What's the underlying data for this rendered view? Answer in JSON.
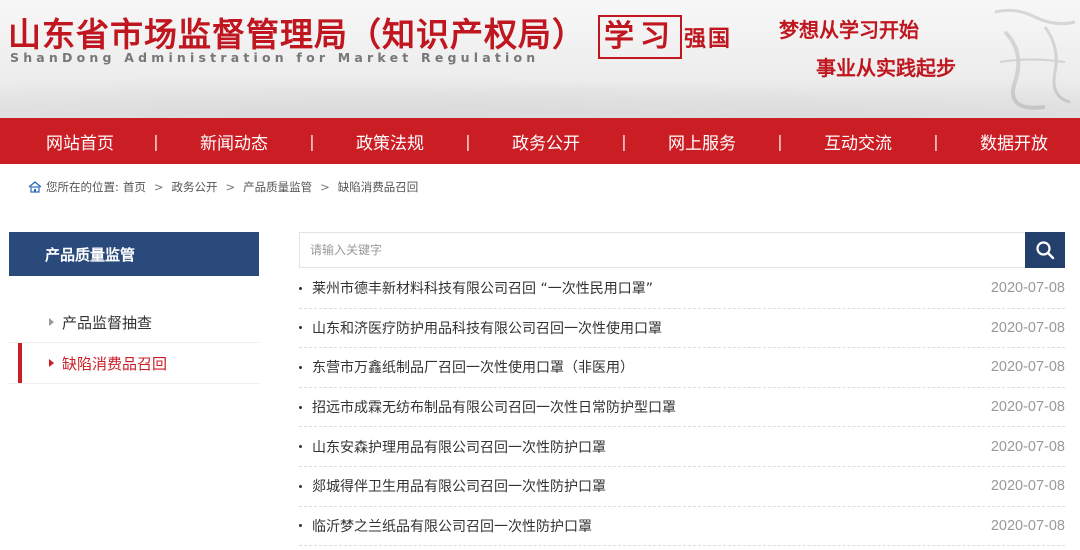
{
  "header": {
    "title": "山东省市场监督管理局（知识产权局）",
    "subtitle": "ShanDong Administration for Market Regulation",
    "xuexi_box": "学习",
    "xuexi_small": "强国",
    "slogan_line1": "梦想从学习开始",
    "slogan_line2": "事业从实践起步"
  },
  "nav": {
    "items": [
      "网站首页",
      "新闻动态",
      "政策法规",
      "政务公开",
      "网上服务",
      "互动交流",
      "数据开放"
    ],
    "separator": "|"
  },
  "breadcrumb": {
    "prefix": "您所在的位置:",
    "items": [
      "首页",
      "政务公开",
      "产品质量监管",
      "缺陷消费品召回"
    ],
    "separator": ">"
  },
  "sidebar": {
    "heading": "产品质量监管",
    "items": [
      {
        "label": "产品监督抽查",
        "active": false
      },
      {
        "label": "缺陷消费品召回",
        "active": true
      }
    ]
  },
  "search": {
    "placeholder": "请输入关键字",
    "value": ""
  },
  "news": [
    {
      "title": "莱州市德丰新材料科技有限公司召回 “一次性民用口罩”",
      "date": "2020-07-08"
    },
    {
      "title": "山东和济医疗防护用品科技有限公司召回一次性使用口罩",
      "date": "2020-07-08"
    },
    {
      "title": "东营市万鑫纸制品厂召回一次性使用口罩（非医用）",
      "date": "2020-07-08"
    },
    {
      "title": "招远市成霖无纺布制品有限公司召回一次性日常防护型口罩",
      "date": "2020-07-08"
    },
    {
      "title": "山东安森护理用品有限公司召回一次性防护口罩",
      "date": "2020-07-08"
    },
    {
      "title": "郯城得伴卫生用品有限公司召回一次性防护口罩",
      "date": "2020-07-08"
    },
    {
      "title": "临沂梦之兰纸品有限公司召回一次性防护口罩",
      "date": "2020-07-08"
    }
  ],
  "colors": {
    "brand_red": "#cb1d24",
    "sidebar_blue": "#2a4a7b",
    "search_button": "#233f6b"
  },
  "icons": {
    "breadcrumb": "home-icon",
    "search": "search-icon",
    "bullet": "bullet-icon",
    "sidebar_arrow": "triangle-right-icon",
    "decoration": "seal-icon"
  }
}
